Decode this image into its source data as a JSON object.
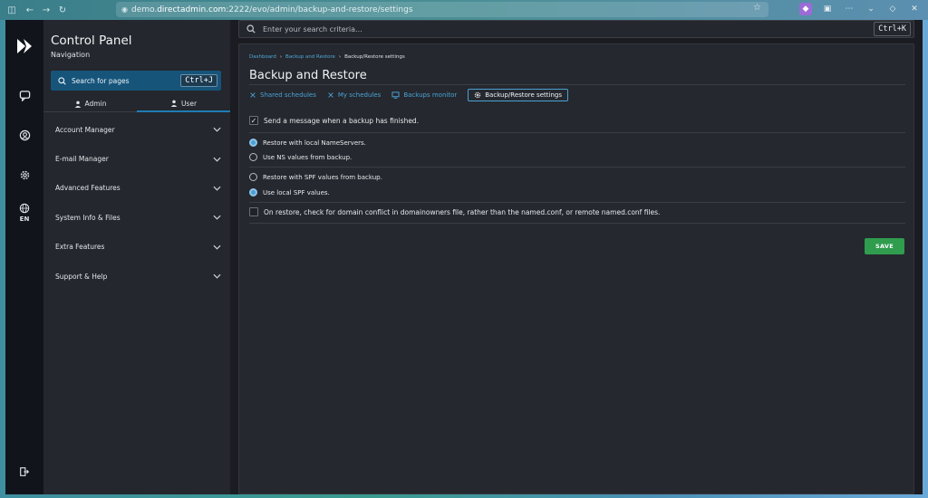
{
  "browser": {
    "url_prefix": "demo.",
    "url_host": "directadmin.com",
    "url_path": ":2222/evo/admin/backup-and-restore/settings"
  },
  "rail": {
    "language": "EN"
  },
  "sidebar": {
    "title": "Control Panel",
    "subtitle": "Navigation",
    "search_label": "Search for pages",
    "search_shortcut": "Ctrl+J",
    "role_tabs": [
      {
        "label": "Admin"
      },
      {
        "label": "User"
      }
    ],
    "menu": [
      {
        "label": "Account Manager"
      },
      {
        "label": "E-mail Manager"
      },
      {
        "label": "Advanced Features"
      },
      {
        "label": "System Info & Files"
      },
      {
        "label": "Extra Features"
      },
      {
        "label": "Support & Help"
      }
    ]
  },
  "main": {
    "search_placeholder": "Enter your search criteria...",
    "search_shortcut": "Ctrl+K",
    "breadcrumb": [
      "Dashboard",
      "Backup and Restore",
      "Backup/Restore settings"
    ],
    "title": "Backup and Restore",
    "tabs": [
      {
        "label": "Shared schedules"
      },
      {
        "label": "My schedules"
      },
      {
        "label": "Backups monitor"
      },
      {
        "label": "Backup/Restore settings"
      }
    ],
    "options": {
      "notify_label": "Send a message when a backup has finished.",
      "ns_local": "Restore with local NameServers.",
      "ns_backup": "Use NS values from backup.",
      "spf_backup": "Restore with SPF values from backup.",
      "spf_local": "Use local SPF values.",
      "domain_conflict": "On restore, check for domain conflict in domainowners file, rather than the named.conf, or remote named.conf files."
    },
    "save_label": "SAVE"
  },
  "colors": {
    "accent": "#4aa3d6",
    "save": "#2f9c4e",
    "search_pages_bg": "#16547a"
  }
}
